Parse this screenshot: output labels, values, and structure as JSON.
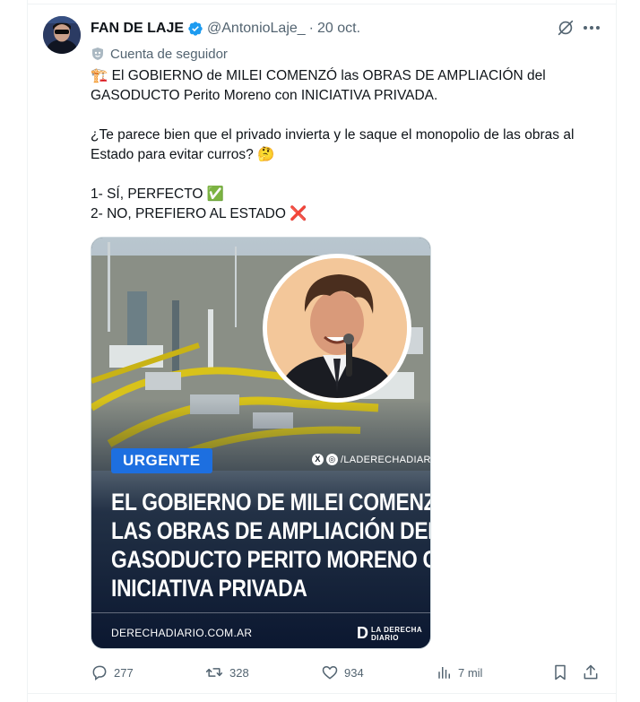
{
  "tweet": {
    "author_name": "FAN DE LAJE",
    "handle": "@AntonioLaje_",
    "separator": "·",
    "date": "20 oct.",
    "follower_label": "Cuenta de seguidor",
    "emoji_crane": "🏗️",
    "text_line1": "El GOBIERNO de MILEI COMENZÓ las OBRAS DE AMPLIACIÓN del GASODUCTO Perito Moreno con INICIATIVA PRIVADA.",
    "text_question": "¿Te parece bien que el privado invierta y le saque el monopolio de las obras al Estado para evitar curros? 🤔",
    "option1": "1- SÍ, PERFECTO ✅",
    "option2": "2- NO, PREFIERO AL ESTADO ❌"
  },
  "media": {
    "badge": "URGENTE",
    "social_handle": "/LADERECHADIARIO",
    "headline_lines": [
      "EL GOBIERNO DE MILEI COMENZÓ",
      "LAS OBRAS DE AMPLIACIÓN DEL",
      "GASODUCTO PERITO MORENO CON",
      "INICIATIVA PRIVADA"
    ],
    "site": "DERECHADIARIO.COM.AR",
    "brand_letter": "D",
    "brand_line1": "LA DERECHA",
    "brand_line2": "DIARIO"
  },
  "actions": {
    "replies": "277",
    "reposts": "328",
    "likes": "934",
    "views": "7 mil"
  },
  "icons": {
    "verified": "verified-badge-icon",
    "grok": "grok-icon",
    "more": "more-icon",
    "reply": "reply-icon",
    "repost": "repost-icon",
    "like": "heart-icon",
    "views": "views-icon",
    "bookmark": "bookmark-icon",
    "share": "share-icon"
  },
  "colors": {
    "text": "#0f1419",
    "secondary": "#536471",
    "verified": "#1d9bf0",
    "badge": "#1d6fe0"
  }
}
